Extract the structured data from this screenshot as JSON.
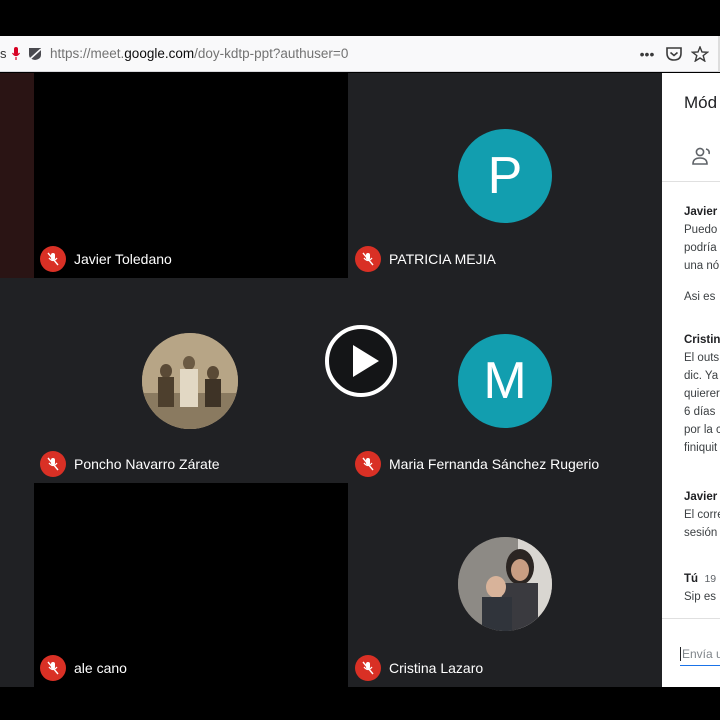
{
  "browser": {
    "url_prefix": "https://meet.",
    "url_domain": "google.com",
    "url_path": "/doy-kdtp-ppt?authuser=0",
    "url_fragment": "s",
    "icons": [
      "microphone-icon",
      "tracking-icon",
      "more-icon",
      "pocket-icon",
      "bookmark-star-icon"
    ]
  },
  "participants": [
    {
      "name": "Javier Toledano",
      "tile": "black"
    },
    {
      "name": "PATRICIA MEJIA",
      "initial": "P",
      "color": "#129eaf"
    },
    {
      "name": "Poncho Navarro Zárate",
      "avatar": "photo"
    },
    {
      "name": "Maria Fernanda Sánchez Rugerio",
      "initial": "M",
      "color": "#129eaf"
    },
    {
      "name": "ale cano",
      "tile": "black"
    },
    {
      "name": "Cristina Lazaro",
      "avatar": "photo"
    }
  ],
  "panel": {
    "title": "Mód",
    "messages": [
      {
        "who": "Javier",
        "lines": [
          "Puedo",
          "podría",
          "una nó"
        ]
      },
      {
        "lines": [
          "Asi es"
        ]
      },
      {
        "who": "Cristin",
        "lines": [
          "El outs",
          "dic. Ya",
          "quierer",
          "6 días",
          "por la c",
          "finiquit"
        ]
      },
      {
        "who": "Javier",
        "lines": [
          "El corre",
          "sesión"
        ]
      },
      {
        "who": "Tú",
        "time": "19",
        "lines": [
          "Sip es"
        ]
      }
    ],
    "compose_placeholder": "Envía u"
  },
  "colors": {
    "mute": "#d93025",
    "avatar": "#129eaf",
    "grid_bg": "#202124"
  }
}
